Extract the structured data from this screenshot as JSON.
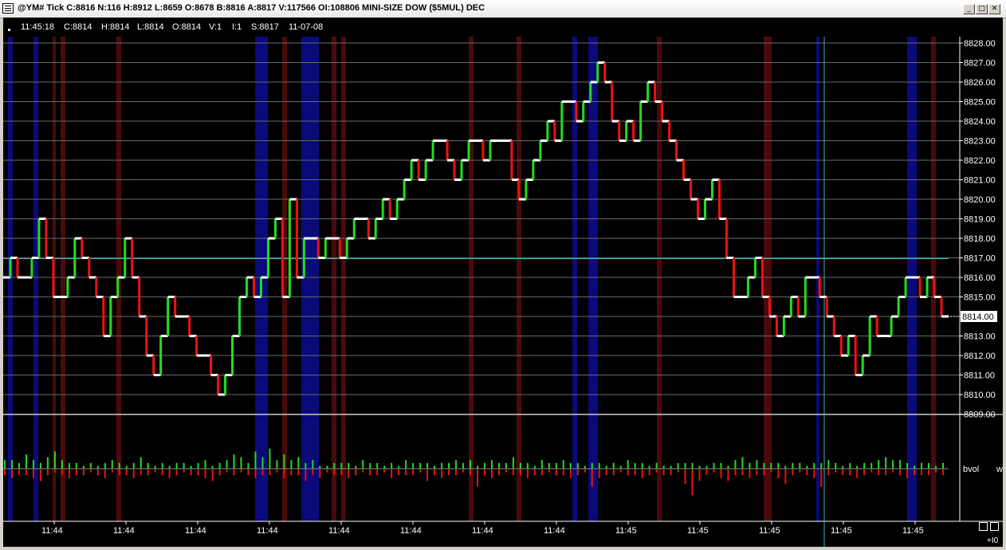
{
  "window": {
    "title": "@YM# Tick C:8816 N:116 H:8912 L:8659 O:8678 B:8816 A:8817 V:117566 OI:108806 MINI-SIZE DOW ($5MUL) DEC",
    "buttons": {
      "minimize": "_",
      "maximize": "□",
      "close": "✕"
    }
  },
  "infobar": {
    "time": "11:45:18",
    "close": "C:8814",
    "high": "H:8814",
    "low": "L:8814",
    "open": "O:8814",
    "volume": "V:1",
    "i": "I:1",
    "s": "S:8817",
    "date": "11-07-08"
  },
  "colors": {
    "up": "#22dd22",
    "down": "#ee1111",
    "flat": "#ffffff",
    "background": "#000000",
    "grid": "#6a6a6a",
    "blue_band": "#0a0a7a",
    "red_band": "#4a0a0a",
    "cursor": "#3fb0c0"
  },
  "chart_data": [
    {
      "type": "line",
      "title": "",
      "y_ticks": [
        "8828.00",
        "8827.00",
        "8826.00",
        "8825.00",
        "8824.00",
        "8823.00",
        "8822.00",
        "8821.00",
        "8820.00",
        "8819.00",
        "8818.00",
        "8817.00",
        "8816.00",
        "8815.00",
        "8814.00",
        "8813.00",
        "8812.00",
        "8811.00",
        "8810.00",
        "8809.00"
      ],
      "ylim": [
        8809,
        8828
      ],
      "last_price_label": "8814.00",
      "x_tick_labels": [
        "11:44",
        "11:44",
        "11:44",
        "11:44",
        "11:44",
        "11:44",
        "11:44",
        "11:44",
        "11:45",
        "11:45",
        "11:45",
        "11:45",
        "11:45"
      ],
      "series": [
        {
          "values": [
            8816,
            8817,
            8816,
            8816,
            8817,
            8819,
            8817,
            8815,
            8815,
            8816,
            8818,
            8817,
            8816,
            8815,
            8813,
            8815,
            8816,
            8818,
            8816,
            8814,
            8812,
            8811,
            8813,
            8815,
            8814,
            8814,
            8813,
            8812,
            8812,
            8811,
            8810,
            8811,
            8813,
            8815,
            8816,
            8815,
            8816,
            8818,
            8819,
            8815,
            8820,
            8816,
            8818,
            8818,
            8817,
            8818,
            8818,
            8817,
            8818,
            8819,
            8819,
            8818,
            8819,
            8820,
            8819,
            8820,
            8821,
            8822,
            8821,
            8822,
            8823,
            8823,
            8822,
            8821,
            8822,
            8823,
            8823,
            8822,
            8823,
            8823,
            8823,
            8821,
            8820,
            8821,
            8822,
            8823,
            8824,
            8823,
            8825,
            8825,
            8824,
            8825,
            8826,
            8827,
            8826,
            8824,
            8823,
            8824,
            8823,
            8825,
            8826,
            8825,
            8824,
            8823,
            8822,
            8821,
            8820,
            8819,
            8820,
            8821,
            8819,
            8817,
            8815,
            8815,
            8816,
            8817,
            8815,
            8814,
            8813,
            8814,
            8815,
            8814,
            8816,
            8816,
            8815,
            8814,
            8813,
            8812,
            8813,
            8811,
            8812,
            8814,
            8813,
            8813,
            8814,
            8815,
            8816,
            8816,
            8815,
            8816,
            8815,
            8814
          ]
        }
      ]
    },
    {
      "type": "bar",
      "title": "",
      "label": "bvol",
      "right_label": "w",
      "series": [
        {
          "name": "up",
          "values": [
            3,
            3,
            2,
            5,
            3,
            2,
            4,
            6,
            3,
            2,
            2,
            1,
            2,
            1,
            2,
            3,
            2,
            1,
            2,
            4,
            2,
            1,
            2,
            1,
            2,
            2,
            1,
            2,
            3,
            1,
            2,
            3,
            5,
            4,
            2,
            6,
            4,
            7,
            3,
            5,
            3,
            4,
            2,
            3,
            1,
            1,
            2,
            2,
            2,
            1,
            3,
            2,
            2,
            1,
            2,
            1,
            3,
            2,
            2,
            2,
            1,
            2,
            2,
            3,
            2,
            3,
            1,
            2,
            3,
            2,
            2,
            4,
            2,
            2,
            1,
            3,
            2,
            2,
            3,
            2,
            2,
            1,
            2,
            2,
            1,
            2,
            1,
            3,
            2,
            2,
            1,
            2,
            1,
            1,
            2,
            2,
            2,
            1,
            1,
            2,
            2,
            1,
            3,
            4,
            2,
            3,
            2,
            2,
            2,
            1,
            2,
            2,
            1,
            2,
            2,
            3,
            2,
            1,
            2,
            1,
            2,
            2,
            3,
            4,
            3,
            3,
            2,
            1,
            2,
            2,
            1,
            2
          ]
        },
        {
          "name": "down",
          "values": [
            2,
            3,
            2,
            2,
            3,
            4,
            2,
            1,
            2,
            3,
            2,
            2,
            1,
            2,
            3,
            1,
            2,
            2,
            3,
            2,
            2,
            1,
            2,
            3,
            2,
            1,
            2,
            2,
            3,
            4,
            2,
            1,
            2,
            1,
            2,
            3,
            2,
            2,
            1,
            3,
            2,
            2,
            4,
            2,
            3,
            1,
            2,
            2,
            3,
            2,
            1,
            2,
            2,
            1,
            3,
            2,
            2,
            2,
            1,
            4,
            2,
            3,
            2,
            2,
            1,
            2,
            6,
            2,
            3,
            2,
            1,
            2,
            2,
            3,
            2,
            2,
            1,
            2,
            2,
            3,
            2,
            1,
            6,
            3,
            2,
            2,
            1,
            2,
            2,
            3,
            2,
            1,
            2,
            2,
            1,
            5,
            9,
            4,
            2,
            1,
            3,
            4,
            2,
            2,
            3,
            2,
            2,
            1,
            3,
            5,
            2,
            1,
            2,
            3,
            6,
            2,
            1,
            2,
            2,
            3,
            2,
            1,
            2,
            2,
            1,
            2,
            3,
            2,
            2,
            2,
            1,
            2
          ]
        }
      ]
    }
  ]
}
